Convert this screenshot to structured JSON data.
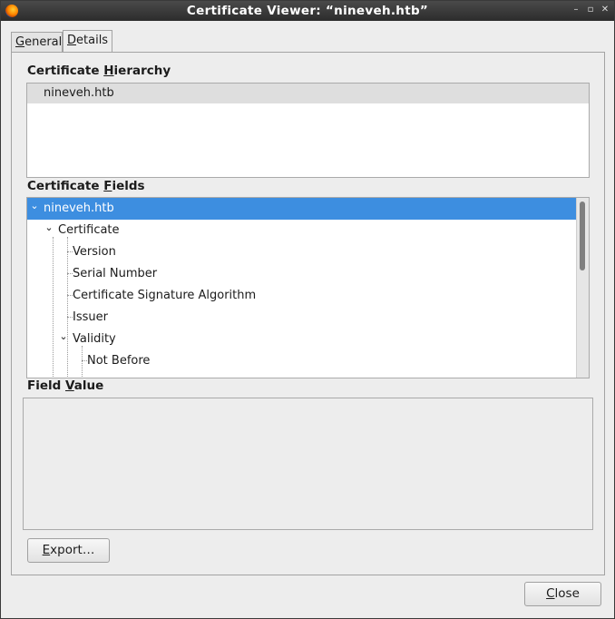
{
  "window": {
    "title": "Certificate Viewer: “nineveh.htb”",
    "icon": "firefox-icon",
    "controls": {
      "minimize": "–",
      "maximize": "▫",
      "close": "✕"
    }
  },
  "tabs": [
    {
      "pre": "",
      "mn": "G",
      "post": "eneral",
      "selected": false
    },
    {
      "pre": "",
      "mn": "D",
      "post": "etails",
      "selected": true
    }
  ],
  "hierarchy": {
    "label": {
      "pre": "Certificate ",
      "mn": "H",
      "post": "ierarchy"
    },
    "items": [
      "nineveh.htb"
    ]
  },
  "fields": {
    "label": {
      "pre": "Certificate ",
      "mn": "F",
      "post": "ields"
    },
    "tree": [
      {
        "label": "nineveh.htb",
        "depth": 0,
        "expanded": true,
        "selected": true
      },
      {
        "label": "Certificate",
        "depth": 1,
        "expanded": true,
        "selected": false
      },
      {
        "label": "Version",
        "depth": 2,
        "expanded": null,
        "selected": false
      },
      {
        "label": "Serial Number",
        "depth": 2,
        "expanded": null,
        "selected": false
      },
      {
        "label": "Certificate Signature Algorithm",
        "depth": 2,
        "expanded": null,
        "selected": false
      },
      {
        "label": "Issuer",
        "depth": 2,
        "expanded": null,
        "selected": false
      },
      {
        "label": "Validity",
        "depth": 2,
        "expanded": true,
        "selected": false
      },
      {
        "label": "Not Before",
        "depth": 3,
        "expanded": null,
        "selected": false
      }
    ]
  },
  "field_value": {
    "label": {
      "pre": "Field ",
      "mn": "V",
      "post": "alue"
    },
    "value": ""
  },
  "buttons": {
    "export": {
      "pre": "",
      "mn": "E",
      "post": "xport…"
    },
    "close": {
      "pre": "",
      "mn": "C",
      "post": "lose"
    }
  },
  "colors": {
    "selection": "#3d8ee0",
    "titlebar": "#333333"
  }
}
